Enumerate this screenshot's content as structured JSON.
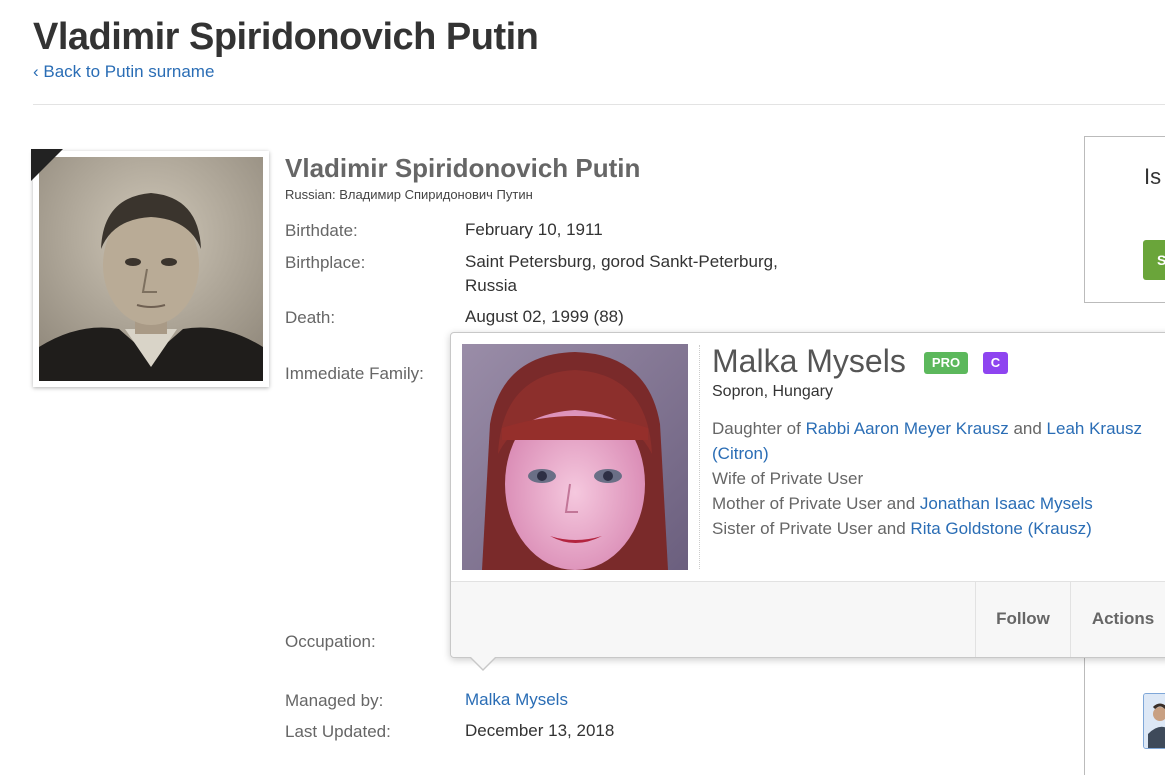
{
  "header": {
    "title": "Vladimir Spiridonovich Putin",
    "back_link": "‹ Back to Putin surname"
  },
  "profile": {
    "name": "Vladimir Spiridonovich Putin",
    "native_name": "Russian: Владимир Спиридонович Путин",
    "fields": {
      "birthdate": {
        "label": "Birthdate:",
        "value": "February 10, 1911"
      },
      "birthplace": {
        "label": "Birthplace:",
        "value_line1": "Saint Petersburg, gorod Sankt-Peterburg,",
        "value_line2": "Russia"
      },
      "death": {
        "label": "Death:",
        "value": "August 02, 1999 (88)"
      },
      "immediate_family": {
        "label": "Immediate Family:"
      },
      "occupation": {
        "label": "Occupation:"
      },
      "managed_by": {
        "label": "Managed by:",
        "value": "Malka Mysels"
      },
      "last_updated": {
        "label": "Last Updated:",
        "value": "December 13, 2018"
      }
    }
  },
  "sidebar": {
    "partial_text": "Is",
    "partial_button": "S"
  },
  "popover": {
    "name": "Malka Mysels",
    "badge_pro": "PRO",
    "badge_c": "C",
    "location": "Sopron, Hungary",
    "relations": {
      "daughter_prefix": "Daughter of ",
      "father": "Rabbi Aaron Meyer Krausz",
      "and1": " and ",
      "mother": "Leah Krausz (Citron)",
      "wife": "Wife of Private User",
      "mother_of_prefix": "Mother of Private User and ",
      "son": "Jonathan Isaac Mysels",
      "sister_prefix": "Sister of Private User and ",
      "sister": "Rita Goldstone (Krausz)"
    },
    "follow_label": "Follow",
    "actions_label": "Actions"
  },
  "colors": {
    "link": "#2a6db5",
    "pro_badge": "#5cb85c",
    "c_badge": "#8e44f0",
    "side_button": "#6aa53a"
  }
}
